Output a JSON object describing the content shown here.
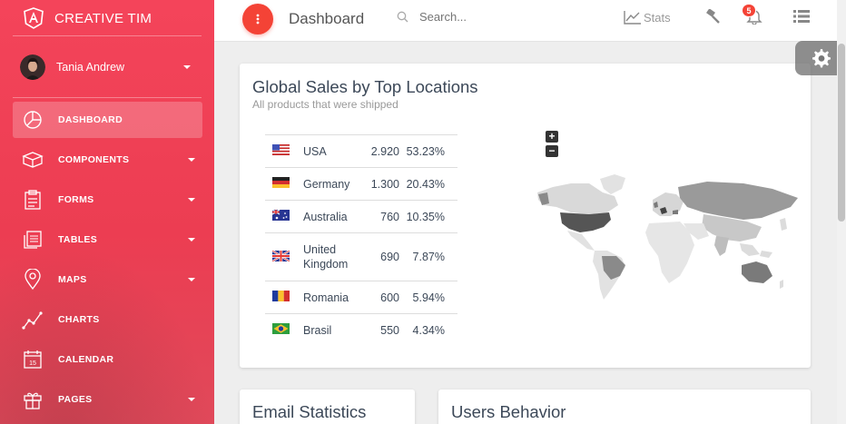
{
  "brand": {
    "name": "CREATIVE TIM"
  },
  "user": {
    "name": "Tania Andrew"
  },
  "sidebar": {
    "items": [
      {
        "label": "DASHBOARD",
        "icon": "dashboard-icon",
        "active": true,
        "has_caret": false
      },
      {
        "label": "COMPONENTS",
        "icon": "components-icon",
        "active": false,
        "has_caret": true
      },
      {
        "label": "FORMS",
        "icon": "forms-icon",
        "active": false,
        "has_caret": true
      },
      {
        "label": "TABLES",
        "icon": "tables-icon",
        "active": false,
        "has_caret": true
      },
      {
        "label": "MAPS",
        "icon": "maps-icon",
        "active": false,
        "has_caret": true
      },
      {
        "label": "CHARTS",
        "icon": "charts-icon",
        "active": false,
        "has_caret": false
      },
      {
        "label": "CALENDAR",
        "icon": "calendar-icon",
        "active": false,
        "has_caret": false
      },
      {
        "label": "PAGES",
        "icon": "pages-icon",
        "active": false,
        "has_caret": true
      }
    ]
  },
  "topbar": {
    "title": "Dashboard",
    "search_placeholder": "Search...",
    "stats_label": "Stats",
    "notification_count": "5"
  },
  "sales": {
    "title": "Global Sales by Top Locations",
    "subtitle": "All products that were shipped",
    "rows": [
      {
        "flag": "us-flag-icon",
        "country": "USA",
        "value": "2.920",
        "percent": "53.23%"
      },
      {
        "flag": "de-flag-icon",
        "country": "Germany",
        "value": "1.300",
        "percent": "20.43%"
      },
      {
        "flag": "au-flag-icon",
        "country": "Australia",
        "value": "760",
        "percent": "10.35%"
      },
      {
        "flag": "gb-flag-icon",
        "country": "United Kingdom",
        "value": "690",
        "percent": "7.87%"
      },
      {
        "flag": "ro-flag-icon",
        "country": "Romania",
        "value": "600",
        "percent": "5.94%"
      },
      {
        "flag": "br-flag-icon",
        "country": "Brasil",
        "value": "550",
        "percent": "4.34%"
      }
    ],
    "map": {
      "zoom_in": "+",
      "zoom_out": "−"
    }
  },
  "cards": {
    "email_title": "Email Statistics",
    "behavior_title": "Users Behavior"
  },
  "colors": {
    "accent": "#f44336",
    "sidebar": "#f24157"
  }
}
